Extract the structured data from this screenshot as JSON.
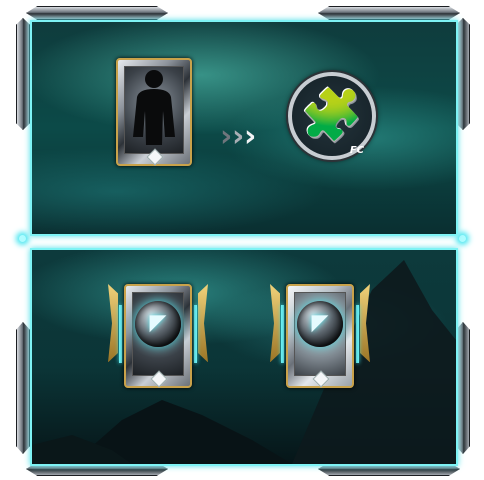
{
  "colors": {
    "panel_border": "#7ef3f5",
    "card_gold": "#c9a24a",
    "arrow_light": "#f2f4f6",
    "arrow_dark": "#6f757c"
  },
  "conversion": {
    "source_card": "player-silhouette-card",
    "arrows": [
      "›",
      "›",
      "›"
    ],
    "target_icon": "puzzle-piece-icon",
    "target_glyph": "🧩",
    "target_badge": "FC"
  },
  "rewards": {
    "cards": [
      {
        "icon": "orb-card",
        "logo_glyph": "◤"
      },
      {
        "icon": "orb-card",
        "logo_glyph": "◤"
      }
    ]
  }
}
